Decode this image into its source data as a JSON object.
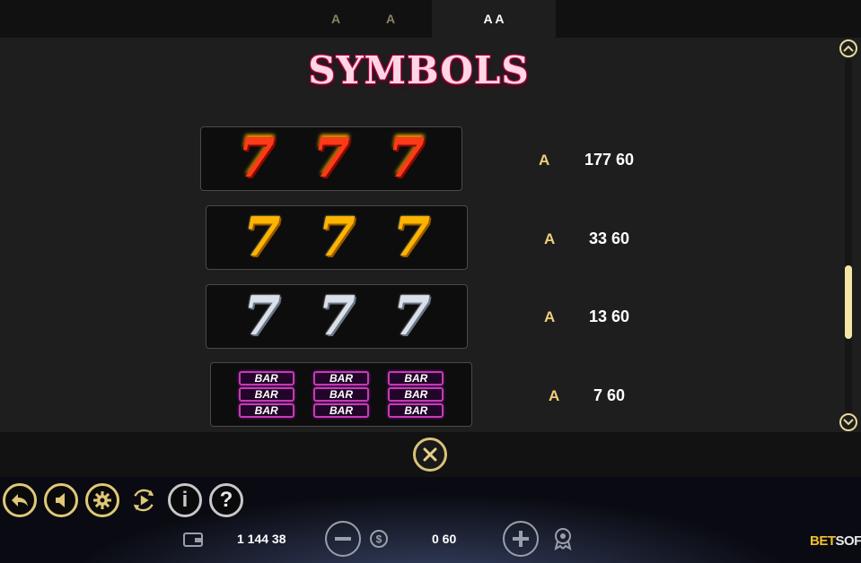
{
  "tabs": [
    {
      "label": "A"
    },
    {
      "label": "A"
    },
    {
      "label": "A A"
    }
  ],
  "title": "SYMBOLS",
  "paytable": [
    {
      "symbol": "red-777",
      "glyph": "7",
      "multiplier_letter": "A",
      "payout": "177 60"
    },
    {
      "symbol": "gold-777",
      "glyph": "7",
      "multiplier_letter": "A",
      "payout": "33 60"
    },
    {
      "symbol": "silver-777",
      "glyph": "7",
      "multiplier_letter": "A",
      "payout": "13 60"
    },
    {
      "symbol": "triple-bar",
      "glyph": "BAR",
      "multiplier_letter": "A",
      "payout": "7 60"
    }
  ],
  "scroll": {
    "up_icon": "chevron-up-icon",
    "down_icon": "chevron-down-icon",
    "position_fraction": 0.7
  },
  "controls": {
    "back_icon": "back-arrow-icon",
    "sound_icon": "speaker-icon",
    "settings_icon": "gear-icon",
    "autoplay_icon": "autoplay-icon",
    "info_label": "i",
    "help_label": "?"
  },
  "status": {
    "balance": "1 144 38",
    "bet": "0 60"
  },
  "brand": {
    "bet": "BET",
    "soft": "SOFT"
  },
  "colors": {
    "accent_gold": "#e0c878",
    "title_pink": "#c40a56"
  }
}
